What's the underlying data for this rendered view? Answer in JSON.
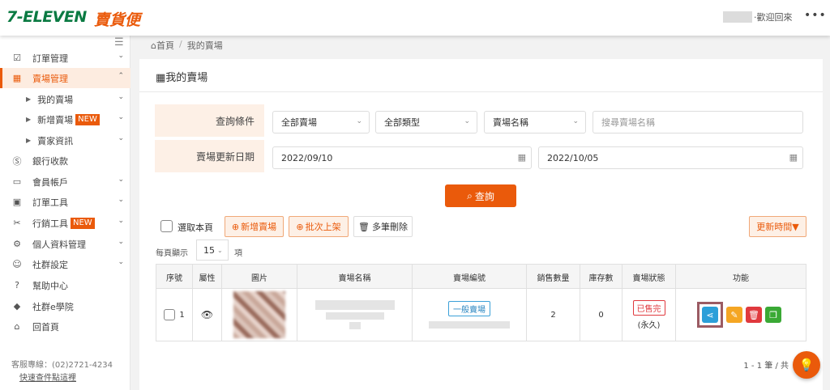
{
  "brand": {
    "logo_main": "7-ELEVEN",
    "logo_sub": "賣貨便"
  },
  "header": {
    "welcome": "‧歡迎回來",
    "more_icon": "more-icon"
  },
  "sidebar": {
    "items": [
      {
        "label": "訂單管理",
        "icon": "clipboard-icon"
      },
      {
        "label": "賣場管理",
        "icon": "store-icon"
      },
      {
        "label": "我的賣場"
      },
      {
        "label": "新增賣場",
        "badge": "NEW"
      },
      {
        "label": "賣家資訊"
      },
      {
        "label": "銀行收款",
        "icon": "dollar-icon"
      },
      {
        "label": "會員帳戶",
        "icon": "wallet-icon"
      },
      {
        "label": "訂單工具",
        "icon": "briefcase-icon"
      },
      {
        "label": "行銷工具",
        "icon": "scissors-icon",
        "badge": "NEW"
      },
      {
        "label": "個人資料管理",
        "icon": "gear-icon"
      },
      {
        "label": "社群設定",
        "icon": "users-icon"
      },
      {
        "label": "幫助中心",
        "icon": "question-icon"
      },
      {
        "label": "社群e學院",
        "icon": "graduation-icon"
      },
      {
        "label": "回首頁",
        "icon": "home-icon"
      }
    ],
    "hotline": "客服專線：(02)2721-4234",
    "track_link": "快速查件點這裡"
  },
  "breadcrumb": {
    "home": "首頁",
    "separator": "/",
    "current": "我的賣場"
  },
  "page": {
    "title": "我的賣場"
  },
  "filters": {
    "query_label": "查詢條件",
    "date_label": "賣場更新日期",
    "store_select": "全部賣場",
    "type_select": "全部類型",
    "field_select": "賣場名稱",
    "search_placeholder": "搜尋賣場名稱",
    "date_from": "2022/09/10",
    "date_to": "2022/10/05",
    "search_button": "查詢"
  },
  "toolbar": {
    "select_page": "選取本頁",
    "add_store": "新增賣場",
    "batch_list": "批次上架",
    "multi_delete": "多筆刪除",
    "sort": "更新時間▼",
    "per_page_label": "每頁顯示",
    "per_page_value": "15",
    "per_page_unit": "項"
  },
  "table": {
    "headers": [
      "序號",
      "屬性",
      "圖片",
      "賣場名稱",
      "賣場編號",
      "銷售數量",
      "庫存數",
      "賣場狀態",
      "功能"
    ],
    "rows": [
      {
        "index": "1",
        "type_tag": "一般賣場",
        "sold": "2",
        "stock": "0",
        "status": "已售完",
        "status_note": "(永久)"
      }
    ]
  },
  "pagination": {
    "summary": "1 - 1 筆 / 共"
  },
  "colors": {
    "accent": "#ea5a0b",
    "brand_green": "#0a7a42",
    "share": "#2b9fd9",
    "edit": "#f5a623",
    "delete": "#e0393e",
    "copy": "#3aa935"
  }
}
